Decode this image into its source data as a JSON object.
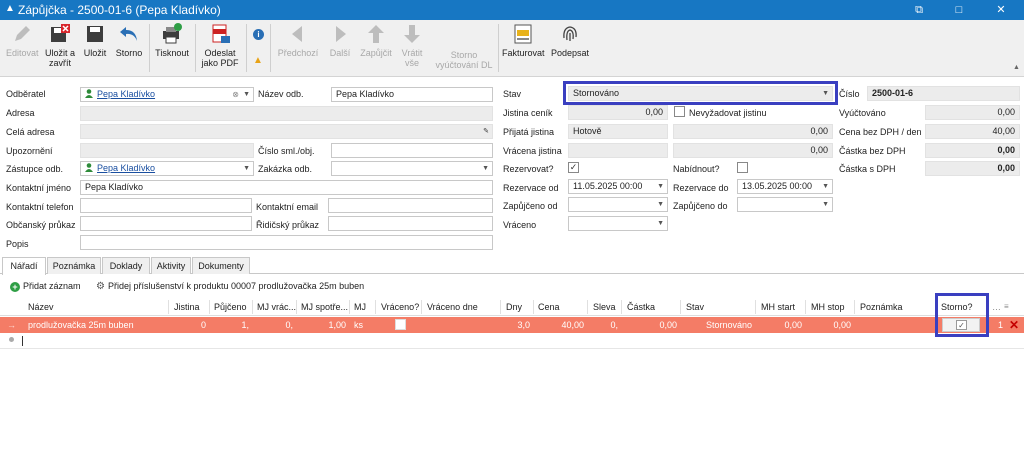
{
  "window": {
    "title": "Zápůjčka - 2500-01-6  (Pepa Kladívko)",
    "restore_glyph": "⧉",
    "maximize_glyph": "□",
    "close_glyph": "✕"
  },
  "toolbar": {
    "edit": "Editovat",
    "save_close": "Uložit a zavřít",
    "save": "Uložit",
    "cancel": "Storno",
    "print": "Tisknout",
    "send_pdf": "Odeslat jako PDF",
    "prev": "Předchozí",
    "next": "Další",
    "lend": "Zapůjčit",
    "return_all": "Vrátit vše",
    "cancel_settle": "Storno vyúčtování DL",
    "invoice": "Fakturovat",
    "sign": "Podepsat"
  },
  "form": {
    "customer_label": "Odběratel",
    "customer_value": "Pepa Kladívko",
    "customer_name_label": "Název odb.",
    "customer_name_value": "Pepa Kladívko",
    "address_label": "Adresa",
    "full_address_label": "Celá adresa",
    "warning_label": "Upozornění",
    "contract_no_label": "Číslo sml./obj.",
    "rep_label": "Zástupce odb.",
    "rep_value": "Pepa Kladívko",
    "order_label": "Zakázka odb.",
    "contact_name_label": "Kontaktní jméno",
    "contact_name_value": "Pepa Kladívko",
    "contact_phone_label": "Kontaktní telefon",
    "contact_email_label": "Kontaktní email",
    "id_card_label": "Občanský průkaz",
    "license_label": "Řidičský průkaz",
    "note_label": "Popis",
    "state_label": "Stav",
    "state_value": "Stornováno",
    "number_label": "Číslo",
    "number_value": "2500-01-6",
    "deposit_list_label": "Jistina ceník",
    "deposit_list_value": "0,00",
    "no_deposit_label": "Nevyžadovat jistinu",
    "billed_label": "Vyúčtováno",
    "billed_value": "0,00",
    "deposit_recv_label": "Přijatá jistina",
    "deposit_recv_type": "Hotově",
    "deposit_recv_value": "0,00",
    "price_day_label": "Cena bez DPH / den",
    "price_day_value": "40,00",
    "deposit_ret_label": "Vrácena jistina",
    "deposit_ret_value": "0,00",
    "amount_novat_label": "Částka bez DPH",
    "amount_novat_value": "0,00",
    "reserve_q_label": "Rezervovat?",
    "offer_q_label": "Nabídnout?",
    "amount_vat_label": "Částka s DPH",
    "amount_vat_value": "0,00",
    "reserve_from_label": "Rezervace od",
    "reserve_from_value": "11.05.2025 00:00",
    "reserve_to_label": "Rezervace do",
    "reserve_to_value": "13.05.2025 00:00",
    "lent_from_label": "Zapůjčeno od",
    "lent_to_label": "Zapůjčeno do",
    "returned_label": "Vráceno"
  },
  "tabs": [
    "Nářadí",
    "Poznámka",
    "Doklady",
    "Aktivity",
    "Dokumenty"
  ],
  "subbar": {
    "add_record": "Přidat záznam",
    "add_accessory": "Přidej příslušenství k produktu 00007 prodlužovačka 25m buben"
  },
  "grid": {
    "headers": {
      "name": "Název",
      "deposit": "Jistina",
      "lent": "Půjčeno",
      "mj_ret": "MJ vrác...",
      "mj_cons": "MJ spotře...",
      "mj": "MJ",
      "returned_q": "Vráceno?",
      "returned_day": "Vráceno dne",
      "days": "Dny",
      "price": "Cena",
      "discount": "Sleva",
      "amount": "Částka",
      "state": "Stav",
      "mh_start": "MH start",
      "mh_stop": "MH stop",
      "note": "Poznámka",
      "storno_q": "Storno?"
    },
    "row": {
      "name": "prodlužovačka 25m buben",
      "deposit": "0",
      "lent": "1,",
      "mj_ret": "0,",
      "mj_cons": "1,00",
      "mj": "ks",
      "days": "3,0",
      "price": "40,00",
      "discount": "0,",
      "amount": "0,00",
      "state": "Stornováno",
      "mh_start": "0,00",
      "mh_stop": "0,00",
      "row_count": "1"
    }
  },
  "colors": {
    "titlebar": "#1777c3",
    "row_highlight": "#f47c66",
    "annotation_box": "#3a3fc0"
  }
}
